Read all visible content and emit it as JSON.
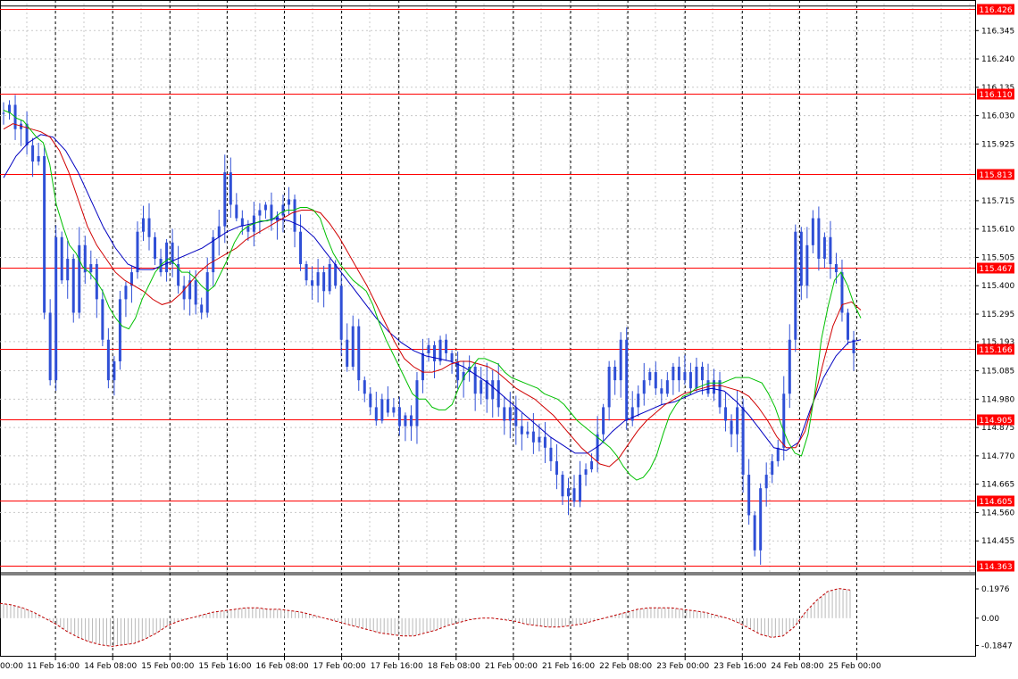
{
  "chart_data": [
    {
      "type": "candlestick",
      "y_ticks": [
        "116.345",
        "116.240",
        "116.135",
        "116.030",
        "115.925",
        "115.715",
        "115.610",
        "115.505",
        "115.400",
        "115.295",
        "115.193",
        "115.085",
        "114.980",
        "114.875",
        "114.770",
        "114.665",
        "114.560",
        "114.455"
      ],
      "ylim": [
        114.34,
        116.445
      ],
      "x_labels": [
        "00:00",
        "11 Feb 16:00",
        "14 Feb 08:00",
        "15 Feb 00:00",
        "15 Feb 16:00",
        "16 Feb 08:00",
        "17 Feb 00:00",
        "17 Feb 16:00",
        "18 Feb 08:00",
        "21 Feb 00:00",
        "21 Feb 16:00",
        "22 Feb 08:00",
        "23 Feb 00:00",
        "23 Feb 16:00",
        "24 Feb 08:00",
        "25 Feb 00:00"
      ],
      "levels": [
        {
          "value": 116.426,
          "label": "116.426",
          "color": "#ff0000"
        },
        {
          "value": 116.11,
          "label": "116.110",
          "color": "#ff0000"
        },
        {
          "value": 115.813,
          "label": "115.813",
          "color": "#ff0000"
        },
        {
          "value": 115.467,
          "label": "115.467",
          "color": "#ff0000"
        },
        {
          "value": 115.166,
          "label": "115.166",
          "color": "#ff0000"
        },
        {
          "value": 114.905,
          "label": "114.905",
          "color": "#ff0000"
        },
        {
          "value": 114.605,
          "label": "114.605",
          "color": "#ff0000"
        },
        {
          "value": 114.363,
          "label": "114.363",
          "color": "#ff0000"
        }
      ],
      "close_path": [
        116.04,
        116.07,
        115.98,
        116.0,
        115.92,
        115.86,
        115.88,
        115.3,
        115.05,
        115.58,
        115.42,
        115.5,
        115.3,
        115.55,
        115.45,
        115.48,
        115.35,
        115.2,
        115.05,
        115.12,
        115.35,
        115.4,
        115.45,
        115.6,
        115.65,
        115.58,
        115.5,
        115.45,
        115.56,
        115.48,
        115.4,
        115.35,
        115.42,
        115.33,
        115.3,
        115.45,
        115.58,
        115.62,
        115.82,
        115.7,
        115.65,
        115.62,
        115.6,
        115.66,
        115.68,
        115.7,
        115.64,
        115.66,
        115.7,
        115.72,
        115.6,
        115.48,
        115.42,
        115.4,
        115.45,
        115.38,
        115.48,
        115.4,
        115.2,
        115.1,
        115.25,
        115.05,
        115.0,
        114.95,
        114.9,
        114.98,
        114.93,
        114.95,
        114.88,
        114.92,
        114.88,
        115.05,
        115.15,
        115.18,
        115.12,
        115.2,
        115.15,
        115.12,
        115.05,
        115.08,
        115.1,
        115.0,
        115.05,
        114.98,
        115.05,
        114.95,
        114.9,
        114.95,
        114.88,
        114.85,
        114.86,
        114.82,
        114.84,
        114.8,
        114.75,
        114.7,
        114.62,
        114.65,
        114.6,
        114.7,
        114.72,
        114.75,
        114.85,
        114.95,
        115.1,
        115.05,
        115.2,
        114.9,
        114.95,
        115.0,
        115.05,
        115.08,
        115.02,
        115.0,
        115.05,
        115.1,
        115.05,
        115.08,
        115.02,
        115.1,
        115.05,
        115.0,
        115.05,
        114.95,
        114.9,
        114.85,
        114.95,
        114.7,
        114.55,
        114.42,
        114.65,
        114.7,
        114.75,
        114.8,
        115.0,
        115.2,
        115.6,
        115.4,
        115.55,
        115.65,
        115.5,
        115.58,
        115.48,
        115.45,
        115.3,
        115.2,
        115.15
      ],
      "ma_green": [
        116.05,
        116.04,
        116.02,
        116.01,
        115.98,
        115.95,
        115.93,
        115.85,
        115.7,
        115.62,
        115.55,
        115.52,
        115.47,
        115.45,
        115.42,
        115.38,
        115.32,
        115.28,
        115.25,
        115.24,
        115.28,
        115.35,
        115.4,
        115.45,
        115.48,
        115.5,
        115.48,
        115.45,
        115.45,
        115.43,
        115.4,
        115.38,
        115.4,
        115.45,
        115.5,
        115.56,
        115.6,
        115.62,
        115.63,
        115.64,
        115.64,
        115.65,
        115.67,
        115.68,
        115.68,
        115.69,
        115.69,
        115.68,
        115.65,
        115.58,
        115.52,
        115.48,
        115.45,
        115.42,
        115.4,
        115.38,
        115.33,
        115.26,
        115.2,
        115.15,
        115.1,
        115.05,
        115.0,
        114.98,
        114.98,
        114.95,
        114.94,
        114.94,
        114.96,
        115.02,
        115.07,
        115.1,
        115.13,
        115.13,
        115.12,
        115.11,
        115.08,
        115.06,
        115.05,
        115.04,
        115.03,
        115.02,
        115.0,
        114.99,
        114.98,
        114.96,
        114.93,
        114.9,
        114.88,
        114.86,
        114.84,
        114.82,
        114.8,
        114.77,
        114.73,
        114.7,
        114.68,
        114.69,
        114.72,
        114.77,
        114.85,
        114.92,
        114.96,
        114.99,
        115.0,
        115.02,
        115.03,
        115.04,
        115.04,
        115.04,
        115.05,
        115.06,
        115.06,
        115.06,
        115.05,
        115.04,
        115.0,
        114.95,
        114.88,
        114.82,
        114.78,
        114.77,
        114.85,
        115.0,
        115.2,
        115.32,
        115.42,
        115.45,
        115.4,
        115.33,
        115.28
      ],
      "ma_red": [
        115.98,
        116.0,
        115.99,
        115.98,
        115.97,
        115.95,
        115.9,
        115.82,
        115.72,
        115.62,
        115.55,
        115.5,
        115.45,
        115.42,
        115.4,
        115.38,
        115.35,
        115.33,
        115.34,
        115.37,
        115.41,
        115.45,
        115.48,
        115.5,
        115.52,
        115.54,
        115.57,
        115.59,
        115.61,
        115.63,
        115.65,
        115.67,
        115.68,
        115.68,
        115.67,
        115.63,
        115.58,
        115.52,
        115.46,
        115.4,
        115.33,
        115.26,
        115.19,
        115.13,
        115.1,
        115.08,
        115.08,
        115.09,
        115.11,
        115.12,
        115.12,
        115.11,
        115.1,
        115.08,
        115.05,
        115.02,
        115.0,
        114.98,
        114.95,
        114.92,
        114.88,
        114.84,
        114.8,
        114.77,
        114.74,
        114.73,
        114.76,
        114.81,
        114.86,
        114.9,
        114.93,
        114.96,
        114.98,
        115.0,
        115.01,
        115.02,
        115.03,
        115.03,
        115.02,
        115.01,
        114.99,
        114.95,
        114.9,
        114.84,
        114.8,
        114.8,
        114.86,
        114.98,
        115.12,
        115.25,
        115.33,
        115.34,
        115.31
      ],
      "ma_blue": [
        115.8,
        115.88,
        115.93,
        115.96,
        115.95,
        115.9,
        115.82,
        115.72,
        115.62,
        115.54,
        115.48,
        115.46,
        115.46,
        115.48,
        115.5,
        115.52,
        115.54,
        115.57,
        115.6,
        115.62,
        115.63,
        115.64,
        115.65,
        115.64,
        115.62,
        115.58,
        115.52,
        115.46,
        115.4,
        115.34,
        115.28,
        115.23,
        115.19,
        115.16,
        115.14,
        115.13,
        115.12,
        115.1,
        115.07,
        115.04,
        115.0,
        114.96,
        114.92,
        114.88,
        114.84,
        114.81,
        114.78,
        114.78,
        114.81,
        114.86,
        114.9,
        114.92,
        114.94,
        114.96,
        114.97,
        114.99,
        115.01,
        115.02,
        115.01,
        114.97,
        114.92,
        114.86,
        114.8,
        114.79,
        114.82,
        114.95,
        115.06,
        115.14,
        115.19,
        115.2
      ],
      "osc_ticks": [
        "0.1976",
        "0.00",
        "-0.1847"
      ],
      "osc_ylim": [
        -0.26,
        0.3
      ],
      "osc_values": [
        0.1,
        0.09,
        0.07,
        0.04,
        0.0,
        -0.04,
        -0.09,
        -0.13,
        -0.16,
        -0.18,
        -0.19,
        -0.18,
        -0.17,
        -0.14,
        -0.1,
        -0.05,
        -0.02,
        0.0,
        0.02,
        0.04,
        0.05,
        0.06,
        0.07,
        0.07,
        0.06,
        0.06,
        0.05,
        0.04,
        0.02,
        0.0,
        -0.02,
        -0.04,
        -0.06,
        -0.08,
        -0.1,
        -0.11,
        -0.12,
        -0.12,
        -0.1,
        -0.08,
        -0.05,
        -0.03,
        -0.01,
        0.0,
        0.0,
        -0.01,
        -0.02,
        -0.04,
        -0.05,
        -0.06,
        -0.06,
        -0.05,
        -0.04,
        -0.02,
        0.0,
        0.02,
        0.04,
        0.06,
        0.07,
        0.07,
        0.07,
        0.06,
        0.05,
        0.04,
        0.02,
        0.0,
        -0.03,
        -0.07,
        -0.11,
        -0.13,
        -0.12,
        -0.06,
        0.04,
        0.12,
        0.18,
        0.2,
        0.19
      ],
      "osc_color": "#c00000",
      "up_color": "#2f4fd6",
      "ma_colors": {
        "green": "#00c000",
        "red": "#d00000",
        "blue": "#0000c0"
      }
    }
  ]
}
